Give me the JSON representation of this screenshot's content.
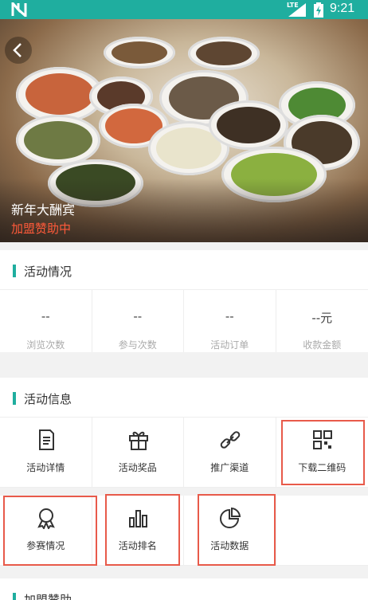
{
  "status_bar": {
    "network": "LTE",
    "time": "9:21"
  },
  "hero": {
    "title": "新年大酬宾",
    "subtitle": "加盟赞助中"
  },
  "activity_status": {
    "heading": "活动情况",
    "stats": [
      {
        "value": "--",
        "label": "浏览次数"
      },
      {
        "value": "--",
        "label": "参与次数"
      },
      {
        "value": "--",
        "label": "活动订单"
      },
      {
        "value": "--元",
        "label": "收款金额"
      }
    ]
  },
  "activity_info": {
    "heading": "活动信息",
    "items": [
      {
        "label": "活动详情",
        "icon": "document-icon"
      },
      {
        "label": "活动奖品",
        "icon": "gift-icon"
      },
      {
        "label": "推广渠道",
        "icon": "link-icon"
      },
      {
        "label": "下载二维码",
        "icon": "qr-code-icon"
      },
      {
        "label": "参赛情况",
        "icon": "award-icon"
      },
      {
        "label": "活动排名",
        "icon": "bar-chart-icon"
      },
      {
        "label": "活动数据",
        "icon": "pie-chart-icon"
      }
    ]
  },
  "sponsorship": {
    "heading": "加盟赞助"
  },
  "colors": {
    "accent": "#1fae9f",
    "highlight_red": "#e85a4a",
    "subtitle_red": "#ff5a3a"
  }
}
